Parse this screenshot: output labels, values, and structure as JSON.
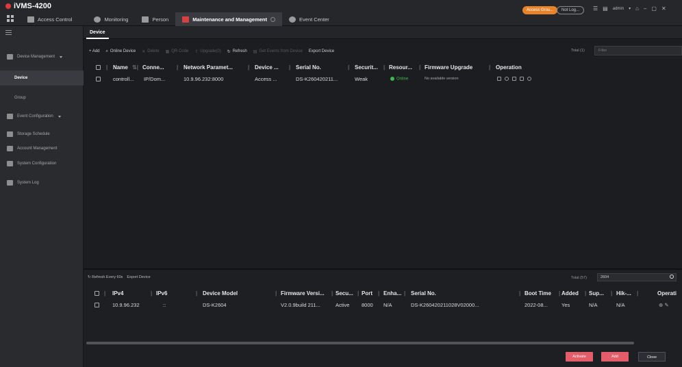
{
  "app": {
    "title": "iVMS-4200"
  },
  "top_tabs": [
    {
      "label": "Access Control"
    },
    {
      "label": "Monitoring"
    },
    {
      "label": "Person"
    },
    {
      "label": "Maintenance and Management"
    },
    {
      "label": "Event Center"
    }
  ],
  "top_right": {
    "pill_orange": "Access Grou...",
    "pill_outline": "Not Log...",
    "user": "admin"
  },
  "sidebar": {
    "items": [
      {
        "label": "Device Management"
      },
      {
        "label": "Device"
      },
      {
        "label": "Group"
      },
      {
        "label": "Event Configuration"
      },
      {
        "label": "Storage Schedule"
      },
      {
        "label": "Account Management"
      },
      {
        "label": "System Configuration"
      },
      {
        "label": "System Log"
      }
    ]
  },
  "subtab": "Device",
  "toolbar": {
    "add": "+ Add",
    "online_device": "Online Device",
    "delete": "Delete",
    "qr_code": "QR Code",
    "upgrade": "Upgrade(0)",
    "refresh": "Refresh",
    "get_events": "Get Events from Device",
    "export": "Export Device",
    "total": "Total (1)",
    "filter_placeholder": "Filter"
  },
  "device_table": {
    "headers": [
      "Name",
      "Conne...",
      "Network Paramet...",
      "Device ...",
      "Serial No.",
      "Securit...",
      "Resour...",
      "Firmware Upgrade",
      "Operation"
    ],
    "rows": [
      {
        "name": "controll...",
        "connection": "IP/Dom...",
        "network": "10.9.96.232:8000",
        "device_type": "Access ...",
        "serial": "DS-K260420211...",
        "security": "Weak",
        "resource": "Online",
        "firmware": "No available version"
      }
    ]
  },
  "online_panel": {
    "refresh": "Refresh Every 60s",
    "export": "Export Device",
    "total": "Total (57)",
    "filter_value": "2604",
    "headers": [
      "IPv4",
      "IPv6",
      "Device Model",
      "Firmware Versi...",
      "Secu...",
      "Port",
      "Enha...",
      "Serial No.",
      "Boot Time",
      "Added",
      "Sup...",
      "Hik-...",
      "Operati"
    ],
    "rows": [
      {
        "ipv4": "10.9.96.232",
        "ipv6": "::",
        "model": "DS-K2604",
        "firmware": "V2.0.9build 211...",
        "security": "Active",
        "port": "8000",
        "enhanced": "N/A",
        "serial": "DS-K260420211028V02000...",
        "boot_time": "2022-08...",
        "added": "Yes",
        "support": "N/A",
        "hik": "N/A"
      }
    ]
  },
  "buttons": {
    "activate": "Activate",
    "add": "Add",
    "close": "Close"
  }
}
